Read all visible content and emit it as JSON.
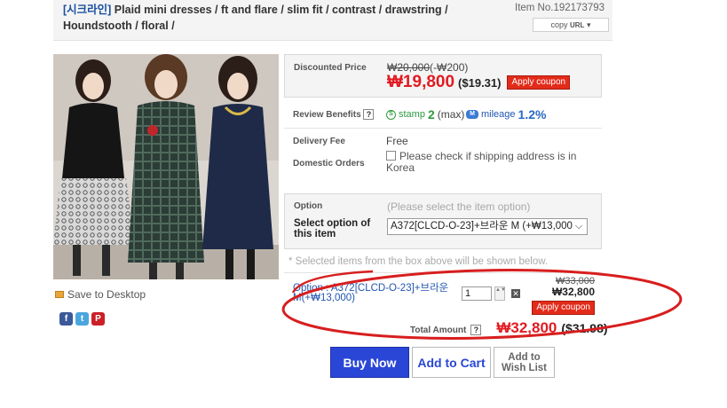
{
  "header": {
    "title_brand": "[시크라인]",
    "title_text": " Plaid mini dresses / ft and flare / slim fit / contrast / drawstring / Houndstooth / floral /",
    "item_no": "Item No.192173793",
    "copy_url_prefix": "copy ",
    "copy_url_word": "URL",
    "copy_url_arrow": "▾"
  },
  "sidebar": {
    "save_desktop": "Save to Desktop",
    "share_icons": [
      "facebook-icon",
      "twitter-icon",
      "pinterest-icon"
    ],
    "share_glyphs": {
      "facebook": "f",
      "twitter": "t",
      "pinterest": "P"
    }
  },
  "price": {
    "label": "Discounted Price",
    "original": "₩20,000",
    "discount": "(-₩200)",
    "sale_won": "₩19,800",
    "sale_usd": "($19.31)",
    "coupon_label": "Apply coupon"
  },
  "review": {
    "label": "Review Benefits",
    "help": "?",
    "stamp_glyph": "S",
    "stamp_word": "stamp",
    "stamp_value": "2",
    "stamp_max": "(max)",
    "mileage_glyph": "M",
    "mileage_word": "mileage",
    "mileage_value": "1.2%"
  },
  "delivery": {
    "fee_label": "Delivery Fee",
    "fee_value": "Free",
    "domestic_label": "Domestic Orders",
    "domestic_note": "Please check if shipping address is in Korea"
  },
  "option": {
    "label": "Option",
    "hint": "(Please select the item option)",
    "select_label": "Select option of this item",
    "selected_value": "A372[CLCD-O-23]+브라운 M (+₩13,000)",
    "arrow": "⌵"
  },
  "selected_note": "* Selected items from the box above will be shown below.",
  "selected_item": {
    "text": "Option : A372[CLCD-O-23]+브라운 M(+₩13,000)",
    "quantity": "1",
    "stepper": "▲▼",
    "remove": "✕",
    "orig_price": "₩33,000",
    "price": "₩32,800",
    "coupon_label": "Apply coupon"
  },
  "total": {
    "label": "Total Amount",
    "help": "?",
    "won": "₩32,800",
    "usd": "($31.98)"
  },
  "actions": {
    "buy_now": "Buy Now",
    "add_to_cart": "Add to Cart",
    "wish_line1": "Add to",
    "wish_line2": "Wish List"
  },
  "colors": {
    "accent_blue": "#2a46d6",
    "price_red": "#e21b22",
    "annotation_red": "#d81e1e"
  }
}
